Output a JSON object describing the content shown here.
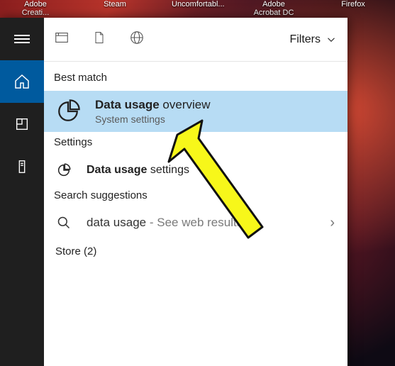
{
  "desktop": {
    "icons": [
      "Adobe Creati...",
      "Steam",
      "Uncomfortabl...",
      "Adobe Acrobat DC",
      "Firefox"
    ]
  },
  "filters_label": "Filters",
  "groups": {
    "best_match": "Best match",
    "settings": "Settings",
    "search_suggestions": "Search suggestions",
    "store": "Store (2)"
  },
  "best_match_item": {
    "bold": "Data usage",
    "rest": " overview",
    "subtitle": "System settings"
  },
  "settings_item": {
    "bold": "Data usage",
    "rest": " settings"
  },
  "suggestion_item": {
    "q": "data usage",
    "hint": " - See web results"
  }
}
